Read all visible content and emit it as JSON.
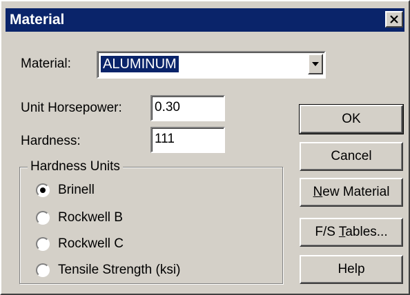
{
  "window": {
    "title": "Material",
    "close_label": "Close"
  },
  "form": {
    "material_label": "Material:",
    "material_value": "ALUMINUM",
    "unit_horsepower_label": "Unit Horsepower:",
    "unit_horsepower_value": "0.30",
    "hardness_label": "Hardness:",
    "hardness_value": "111"
  },
  "hardness_units": {
    "title": "Hardness Units",
    "options": [
      {
        "label": "Brinell",
        "checked": true
      },
      {
        "label": "Rockwell B",
        "checked": false
      },
      {
        "label": "Rockwell C",
        "checked": false
      },
      {
        "label": "Tensile Strength (ksi)",
        "checked": false
      }
    ]
  },
  "buttons": {
    "ok": "OK",
    "cancel": "Cancel",
    "new_material_mnemonic": "N",
    "new_material_rest": "ew Material",
    "fs_tables_prefix": "F/S ",
    "fs_tables_mnemonic": "T",
    "fs_tables_rest": "ables...",
    "help": "Help"
  },
  "colors": {
    "face": "#d4d0c8",
    "titlebar": "#0a246a",
    "selection": "#0a246a"
  }
}
